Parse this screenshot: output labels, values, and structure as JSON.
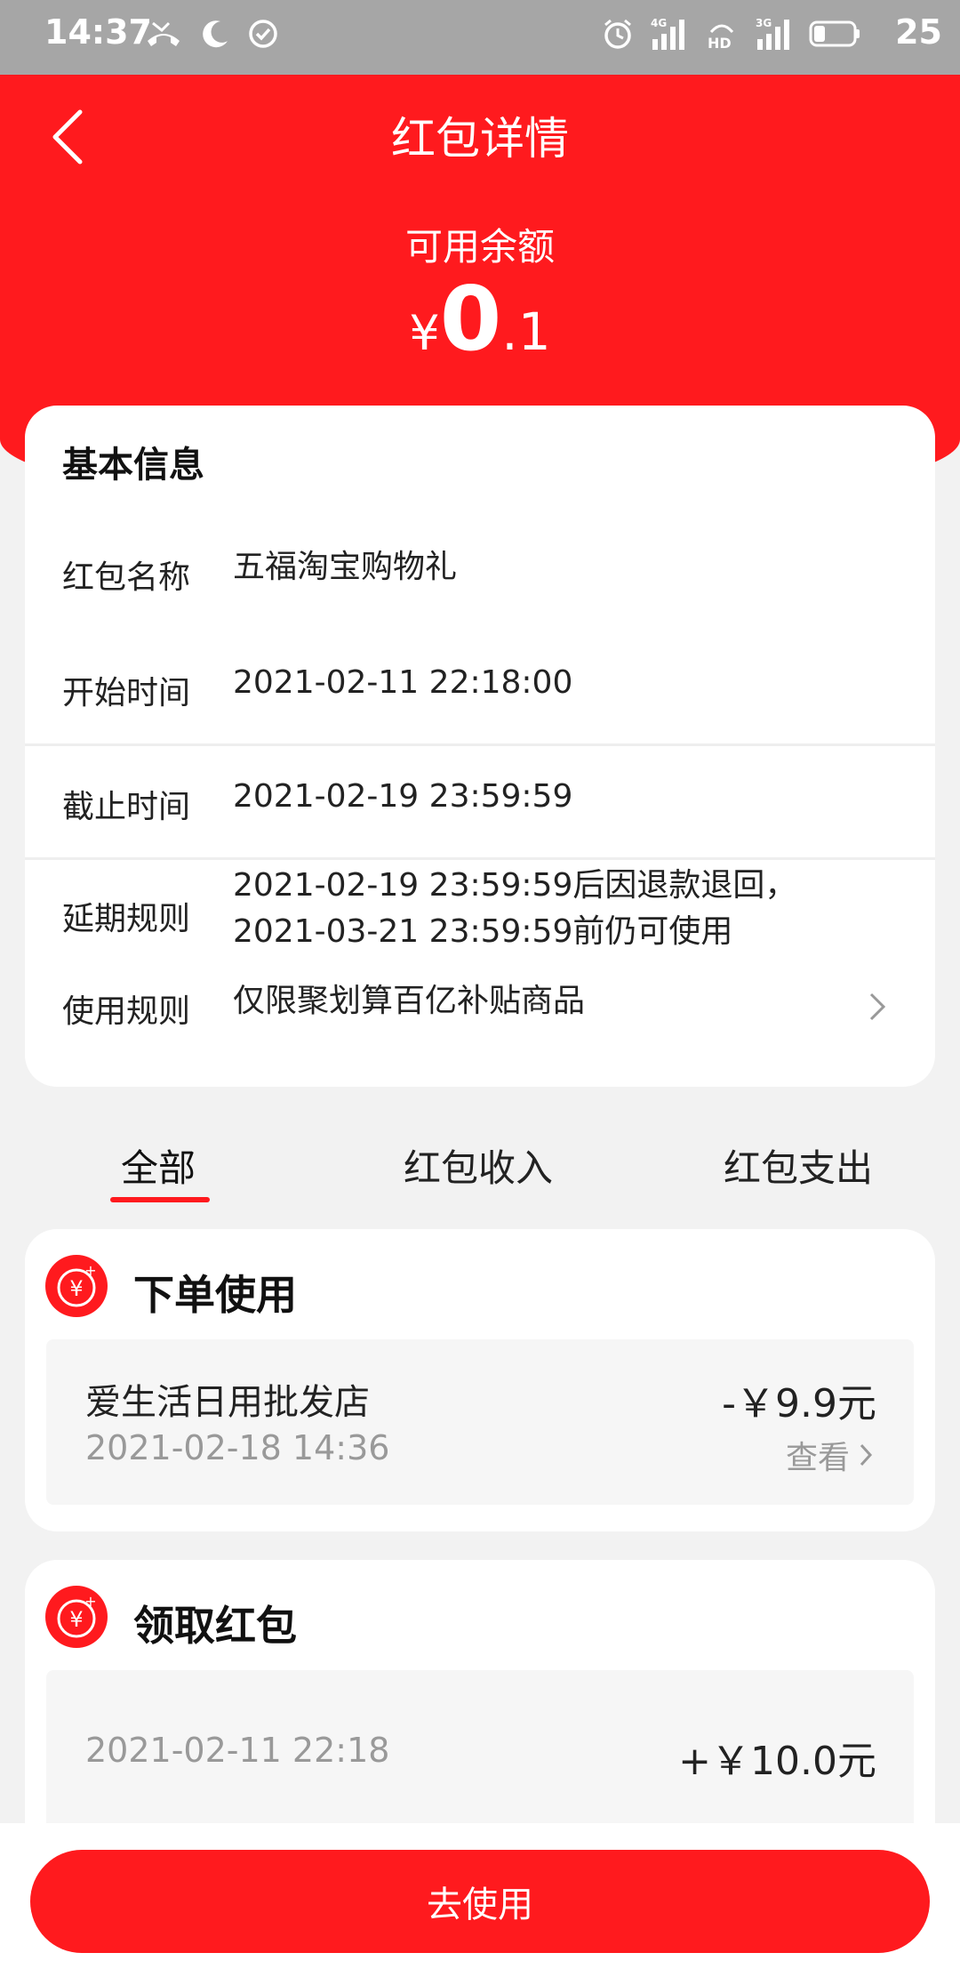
{
  "status_bar": {
    "time": "14:37",
    "battery": "25",
    "left_icons": [
      "missed-call-icon",
      "moon-icon",
      "check-circle-icon"
    ],
    "right_icons": [
      "alarm-icon",
      "signal-4g-icon",
      "hd-icon",
      "signal-3g-icon",
      "battery-icon"
    ]
  },
  "header": {
    "title": "红包详情",
    "balance_label": "可用余额",
    "balance_currency": "¥",
    "balance_integer": "0",
    "balance_decimal": ".1",
    "accent_color": "#ff1a1e"
  },
  "info": {
    "title": "基本信息",
    "rows": [
      {
        "label": "红包名称",
        "value": "五福淘宝购物礼"
      },
      {
        "label": "开始时间",
        "value": "2021-02-11 22:18:00"
      },
      {
        "label": "截止时间",
        "value": "2021-02-19 23:59:59"
      },
      {
        "label": "延期规则",
        "value_line1": "2021-02-19 23:59:59后因退款退回，",
        "value_line2": "2021-03-21 23:59:59前仍可使用"
      },
      {
        "label": "使用规则",
        "value": "仅限聚划算百亿补贴商品"
      }
    ]
  },
  "tabs": [
    {
      "label": "全部",
      "active": true
    },
    {
      "label": "红包收入",
      "active": false
    },
    {
      "label": "红包支出",
      "active": false
    }
  ],
  "records": [
    {
      "title": "下单使用",
      "merchant": "爱生活日用批发店",
      "time": "2021-02-18 14:36",
      "amount": "-￥9.9元",
      "link": "查看"
    },
    {
      "title": "领取红包",
      "time": "2021-02-11 22:18",
      "amount": "+￥10.0元"
    }
  ],
  "bottom": {
    "button_label": "去使用"
  }
}
